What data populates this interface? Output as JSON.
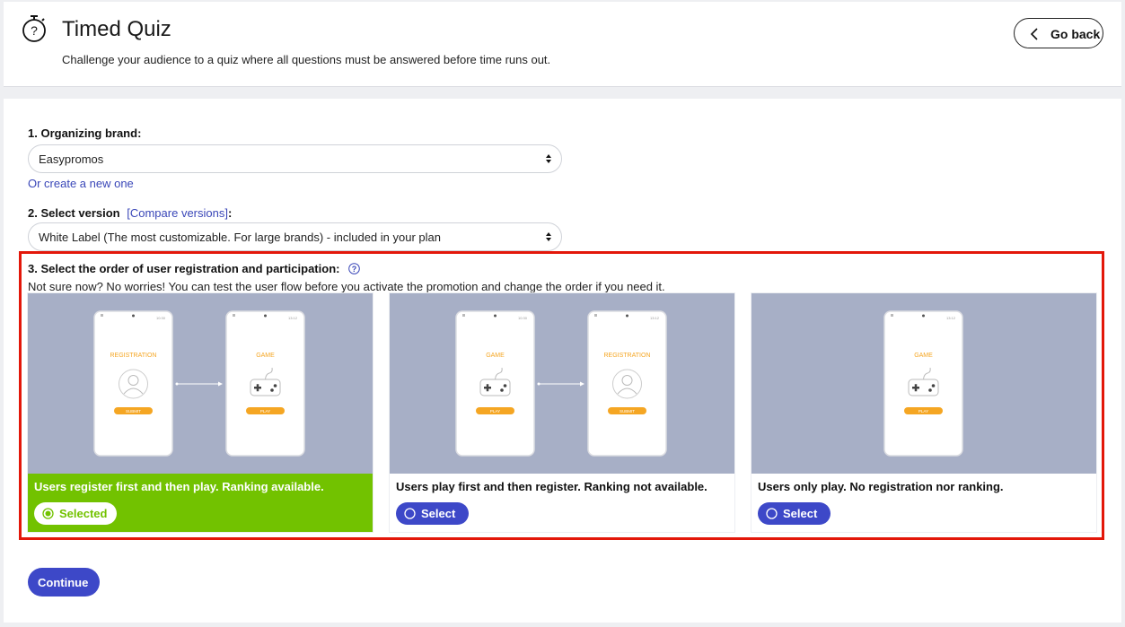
{
  "header": {
    "title": "Timed Quiz",
    "subtitle": "Challenge your audience to a quiz where all questions must be answered before time runs out.",
    "go_back_label": "Go back",
    "icon": "stopwatch-icon"
  },
  "form": {
    "brand_label": "1. Organizing brand:",
    "brand_value": "Easypromos",
    "create_link": "Or create a new one",
    "version_label_prefix": "2. Select version",
    "compare_link": "[Compare versions]",
    "version_label_suffix": ":",
    "version_value": "White Label (The most customizable. For large brands) - included in your plan",
    "order_label": "3. Select the order of user registration and participation:",
    "order_hint": "Not sure now? No worries! You can test the user flow before you activate the promotion and change the order if you need it."
  },
  "cards": [
    {
      "description": "Users register first and then play. Ranking available.",
      "button_label": "Selected",
      "selected": true,
      "phones": [
        {
          "heading": "REGISTRATION",
          "icon": "user-icon",
          "button": "SUBMIT",
          "time": "10:30"
        },
        {
          "heading": "GAME",
          "icon": "gamepad-icon",
          "button": "PLAY",
          "time": "13:12"
        }
      ]
    },
    {
      "description": "Users play first and then register. Ranking not available.",
      "button_label": "Select",
      "selected": false,
      "phones": [
        {
          "heading": "GAME",
          "icon": "gamepad-icon",
          "button": "PLAY",
          "time": "10:30"
        },
        {
          "heading": "REGISTRATION",
          "icon": "user-icon",
          "button": "SUBMIT",
          "time": "13:12"
        }
      ]
    },
    {
      "description": "Users only play. No registration nor ranking.",
      "button_label": "Select",
      "selected": false,
      "phones": [
        {
          "heading": "GAME",
          "icon": "gamepad-icon",
          "button": "PLAY",
          "time": "13:12"
        }
      ]
    }
  ],
  "continue_label": "Continue",
  "colors": {
    "accent": "#3d48c8",
    "selected": "#72c200",
    "highlight": "#e3170a",
    "card_image_bg": "#a7afc6",
    "phone_orange": "#f5a623"
  }
}
